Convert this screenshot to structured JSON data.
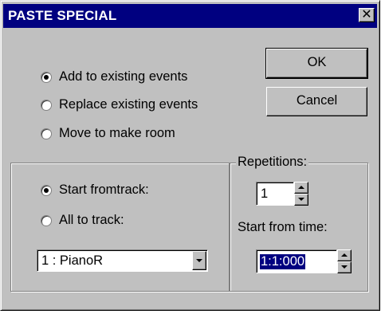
{
  "window": {
    "title": "PASTE SPECIAL",
    "close_glyph": "✕"
  },
  "paste_mode": {
    "options": [
      {
        "label": "Add to existing events",
        "checked": true
      },
      {
        "label": "Replace existing events",
        "checked": false
      },
      {
        "label": "Move to make room",
        "checked": false
      }
    ]
  },
  "buttons": {
    "ok": "OK",
    "cancel": "Cancel"
  },
  "track_group": {
    "options": [
      {
        "label": "Start fromtrack:",
        "checked": true
      },
      {
        "label": "All to track:",
        "checked": false
      }
    ],
    "track_select": {
      "value": "1 : PianoR"
    }
  },
  "repetitions": {
    "label": "Repetitions:",
    "value": "1"
  },
  "start_time": {
    "label": "Start from time:",
    "value": "1:1:000"
  },
  "icons": {
    "close": "close-icon",
    "spin_up": "spin-up-arrow-icon",
    "spin_down": "spin-down-arrow-icon",
    "dropdown": "chevron-down-icon"
  }
}
